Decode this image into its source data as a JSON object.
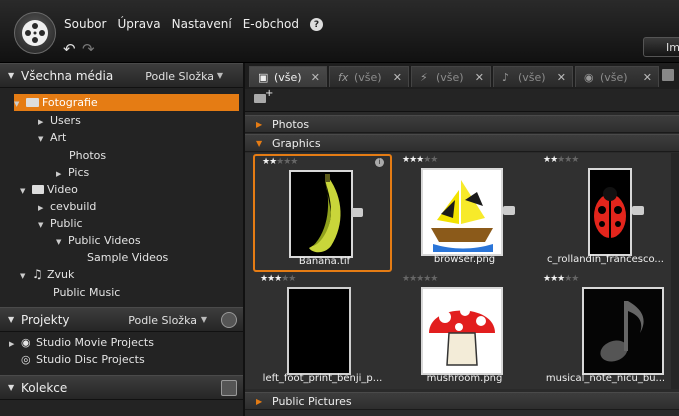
{
  "app": {
    "menu": [
      "Soubor",
      "Úprava",
      "Nastavení",
      "E-obchod"
    ],
    "help_label": "?",
    "import_label": "Im"
  },
  "library": {
    "header": {
      "title": "Všechna média",
      "sort": "Podle Složka"
    },
    "tree": [
      {
        "label": "Fotografie",
        "selected": true
      },
      {
        "label": "Users"
      },
      {
        "label": "Art"
      },
      {
        "label": "Photos"
      },
      {
        "label": "Pics"
      },
      {
        "label": "Video"
      },
      {
        "label": "cevbuild"
      },
      {
        "label": "Public"
      },
      {
        "label": "Public Videos"
      },
      {
        "label": "Sample Videos"
      },
      {
        "label": "Zvuk"
      },
      {
        "label": "Public Music"
      }
    ]
  },
  "projects": {
    "header": {
      "title": "Projekty",
      "sort": "Podle Složka"
    },
    "items": [
      "Studio Movie Projects",
      "Studio Disc Projects"
    ]
  },
  "collections": {
    "header": {
      "title": "Kolekce"
    }
  },
  "tabs": [
    {
      "icon": "photo-icon",
      "label": "(vše)",
      "active": true
    },
    {
      "icon": "fx-icon",
      "glyph": "fx",
      "label": "(vše)"
    },
    {
      "icon": "lightning-icon",
      "glyph": "⚡",
      "label": "(vše)"
    },
    {
      "icon": "note-icon",
      "glyph": "♪",
      "label": "(vše)"
    },
    {
      "icon": "disc-icon",
      "glyph": "◉",
      "label": "(vše)"
    }
  ],
  "groups": {
    "photos": "Photos",
    "graphics": "Graphics",
    "public_pictures": "Public Pictures"
  },
  "thumbnails": [
    {
      "name": "Banana.tif",
      "rating": 2,
      "selected": true
    },
    {
      "name": "browser.png",
      "rating": 3
    },
    {
      "name": "c_rollandin_francesco...",
      "rating": 2
    },
    {
      "name": "left_foot_print_benji_p...",
      "rating": 3
    },
    {
      "name": "mushroom.png",
      "rating": 0
    },
    {
      "name": "musical_note_nicu_bu...",
      "rating": 3
    }
  ],
  "colors": {
    "accent": "#e57c14",
    "background": "#1b1b1b",
    "panel": "#232323"
  }
}
